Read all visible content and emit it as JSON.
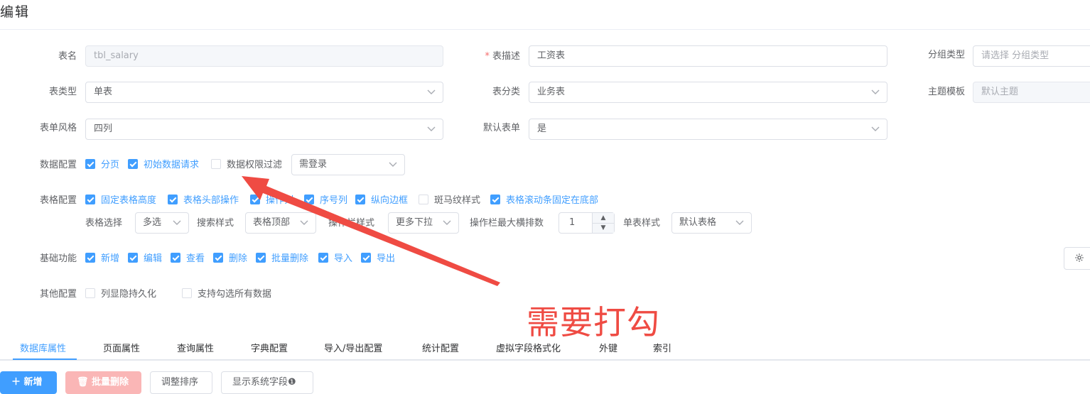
{
  "title": "编辑",
  "form": {
    "table_name": {
      "label": "表名",
      "value": "tbl_salary"
    },
    "table_desc": {
      "label": "表描述",
      "required": "*",
      "value": "工资表"
    },
    "group_type": {
      "label": "分组类型",
      "placeholder": "请选择 分组类型"
    },
    "table_type": {
      "label": "表类型",
      "value": "单表"
    },
    "table_category": {
      "label": "表分类",
      "value": "业务表"
    },
    "theme_template": {
      "label": "主题模板",
      "value": "默认主题"
    },
    "form_style": {
      "label": "表单风格",
      "value": "四列"
    },
    "default_form": {
      "label": "默认表单",
      "value": "是"
    }
  },
  "data_config": {
    "label": "数据配置",
    "paging": {
      "label": "分页",
      "checked": true
    },
    "init_request": {
      "label": "初始数据请求",
      "checked": true
    },
    "permission_filter": {
      "label": "数据权限过滤",
      "checked": false
    },
    "login_select": "需登录"
  },
  "table_config": {
    "label": "表格配置",
    "fixed_height": {
      "label": "固定表格高度",
      "checked": true
    },
    "header_ops": {
      "label": "表格头部操作",
      "checked": true
    },
    "op_column": {
      "label": "操作列",
      "checked": true
    },
    "index_column": {
      "label": "序号列",
      "checked": true
    },
    "vertical_border": {
      "label": "纵向边框",
      "checked": true
    },
    "zebra": {
      "label": "斑马纹样式",
      "checked": false
    },
    "scrollbar_bottom": {
      "label": "表格滚动条固定在底部",
      "checked": true
    },
    "selection_label": "表格选择",
    "selection_value": "多选",
    "search_style_label": "搜索样式",
    "search_style_value": "表格顶部",
    "op_style_label": "操作栏样式",
    "op_style_value": "更多下拉",
    "op_max_label": "操作栏最大横排数",
    "op_max_value": "1",
    "single_style_label": "单表样式",
    "single_style_value": "默认表格"
  },
  "basic_functions": {
    "label": "基础功能",
    "items": [
      {
        "label": "新增",
        "checked": true
      },
      {
        "label": "编辑",
        "checked": true
      },
      {
        "label": "查看",
        "checked": true
      },
      {
        "label": "删除",
        "checked": true
      },
      {
        "label": "批量删除",
        "checked": true
      },
      {
        "label": "导入",
        "checked": true
      },
      {
        "label": "导出",
        "checked": true
      }
    ]
  },
  "other_config": {
    "label": "其他配置",
    "items": [
      {
        "label": "列显隐持久化",
        "checked": false
      },
      {
        "label": "支持勾选所有数据",
        "checked": false
      }
    ]
  },
  "annotation": "需要打勾",
  "annotation_color": "#ef4b43",
  "tabs": [
    "数据库属性",
    "页面属性",
    "查询属性",
    "字典配置",
    "导入/导出配置",
    "统计配置",
    "虚拟字段格式化",
    "外键",
    "索引"
  ],
  "active_tab": "数据库属性",
  "buttons": {
    "add": "新增",
    "batch_delete": "批量删除",
    "sort": "调整排序",
    "show_sys_fields": "显示系统字段"
  },
  "colors": {
    "accent": "#409eff",
    "danger_light": "#fab6b6"
  }
}
